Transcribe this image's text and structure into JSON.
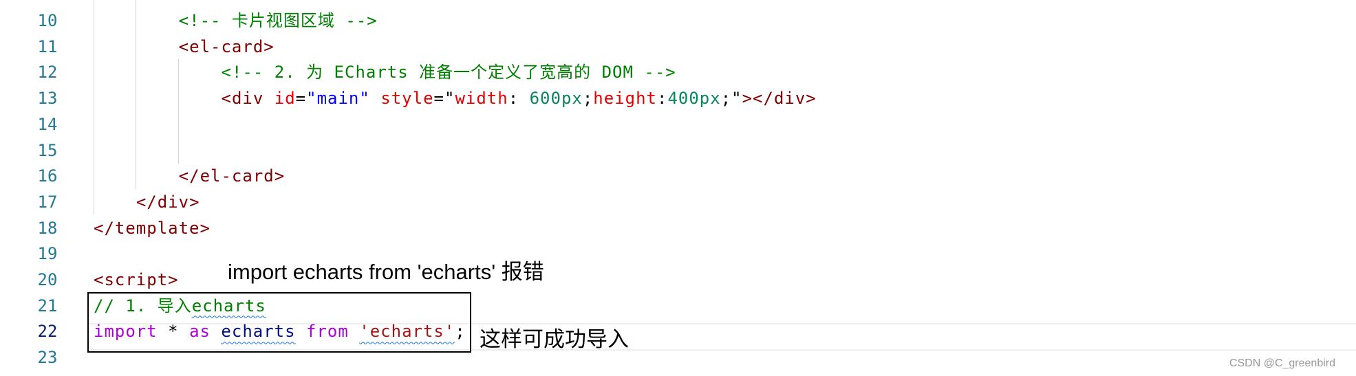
{
  "editor": {
    "current_line": 22,
    "lines": [
      {
        "n": "10",
        "indent": 2,
        "tokens": [
          {
            "t": "<!-- 卡片视图区域 -->",
            "c": "#008000"
          }
        ]
      },
      {
        "n": "11",
        "indent": 2,
        "tokens": [
          {
            "t": "<el-card>",
            "c": "#800000"
          }
        ]
      },
      {
        "n": "12",
        "indent": 3,
        "tokens": [
          {
            "t": "<!-- 2. 为 ECharts 准备一个定义了宽高的 DOM -->",
            "c": "#008000"
          }
        ]
      },
      {
        "n": "13",
        "indent": 3,
        "tokens": [
          {
            "t": "<div ",
            "c": "#800000"
          },
          {
            "t": "id",
            "c": "#e50000"
          },
          {
            "t": "=",
            "c": "#000000"
          },
          {
            "t": "\"main\"",
            "c": "#0000ff"
          },
          {
            "t": " ",
            "c": "#000"
          },
          {
            "t": "style",
            "c": "#e50000"
          },
          {
            "t": "=\"",
            "c": "#000000"
          },
          {
            "t": "width",
            "c": "#e50000"
          },
          {
            "t": ": ",
            "c": "#000"
          },
          {
            "t": "600px",
            "c": "#098658"
          },
          {
            "t": ";",
            "c": "#000"
          },
          {
            "t": "height",
            "c": "#e50000"
          },
          {
            "t": ":",
            "c": "#000"
          },
          {
            "t": "400px",
            "c": "#098658"
          },
          {
            "t": ";\"",
            "c": "#000"
          },
          {
            "t": "></div>",
            "c": "#800000"
          }
        ]
      },
      {
        "n": "14",
        "indent": 3,
        "tokens": []
      },
      {
        "n": "15",
        "indent": 3,
        "tokens": []
      },
      {
        "n": "16",
        "indent": 2,
        "tokens": [
          {
            "t": "</el-card>",
            "c": "#800000"
          }
        ]
      },
      {
        "n": "17",
        "indent": 1,
        "tokens": [
          {
            "t": "</div>",
            "c": "#800000"
          }
        ]
      },
      {
        "n": "18",
        "indent": 0,
        "tokens": [
          {
            "t": "</template>",
            "c": "#800000"
          }
        ]
      },
      {
        "n": "19",
        "indent": 0,
        "tokens": []
      },
      {
        "n": "20",
        "indent": 0,
        "tokens": [
          {
            "t": "<script>",
            "c": "#800000"
          }
        ]
      },
      {
        "n": "21",
        "indent": 0,
        "tokens": [
          {
            "t": "// 1. 导入",
            "c": "#008000"
          },
          {
            "t": "echarts",
            "c": "#008000",
            "squiggle": true
          }
        ]
      },
      {
        "n": "22",
        "indent": 0,
        "tokens": [
          {
            "t": "import",
            "c": "#af00db"
          },
          {
            "t": " * ",
            "c": "#000"
          },
          {
            "t": "as",
            "c": "#af00db"
          },
          {
            "t": " ",
            "c": "#000"
          },
          {
            "t": "echarts",
            "c": "#001080",
            "squiggle": true
          },
          {
            "t": " ",
            "c": "#000"
          },
          {
            "t": "from",
            "c": "#af00db"
          },
          {
            "t": " ",
            "c": "#000"
          },
          {
            "t": "'echarts'",
            "c": "#a31515",
            "squiggle": true
          },
          {
            "t": ";",
            "c": "#000"
          }
        ]
      },
      {
        "n": "23",
        "indent": 0,
        "tokens": []
      }
    ]
  },
  "annotations": {
    "error_note": "import echarts from 'echarts' 报错",
    "success_note": "这样可成功导入"
  },
  "watermark": "CSDN @C_greenbird"
}
